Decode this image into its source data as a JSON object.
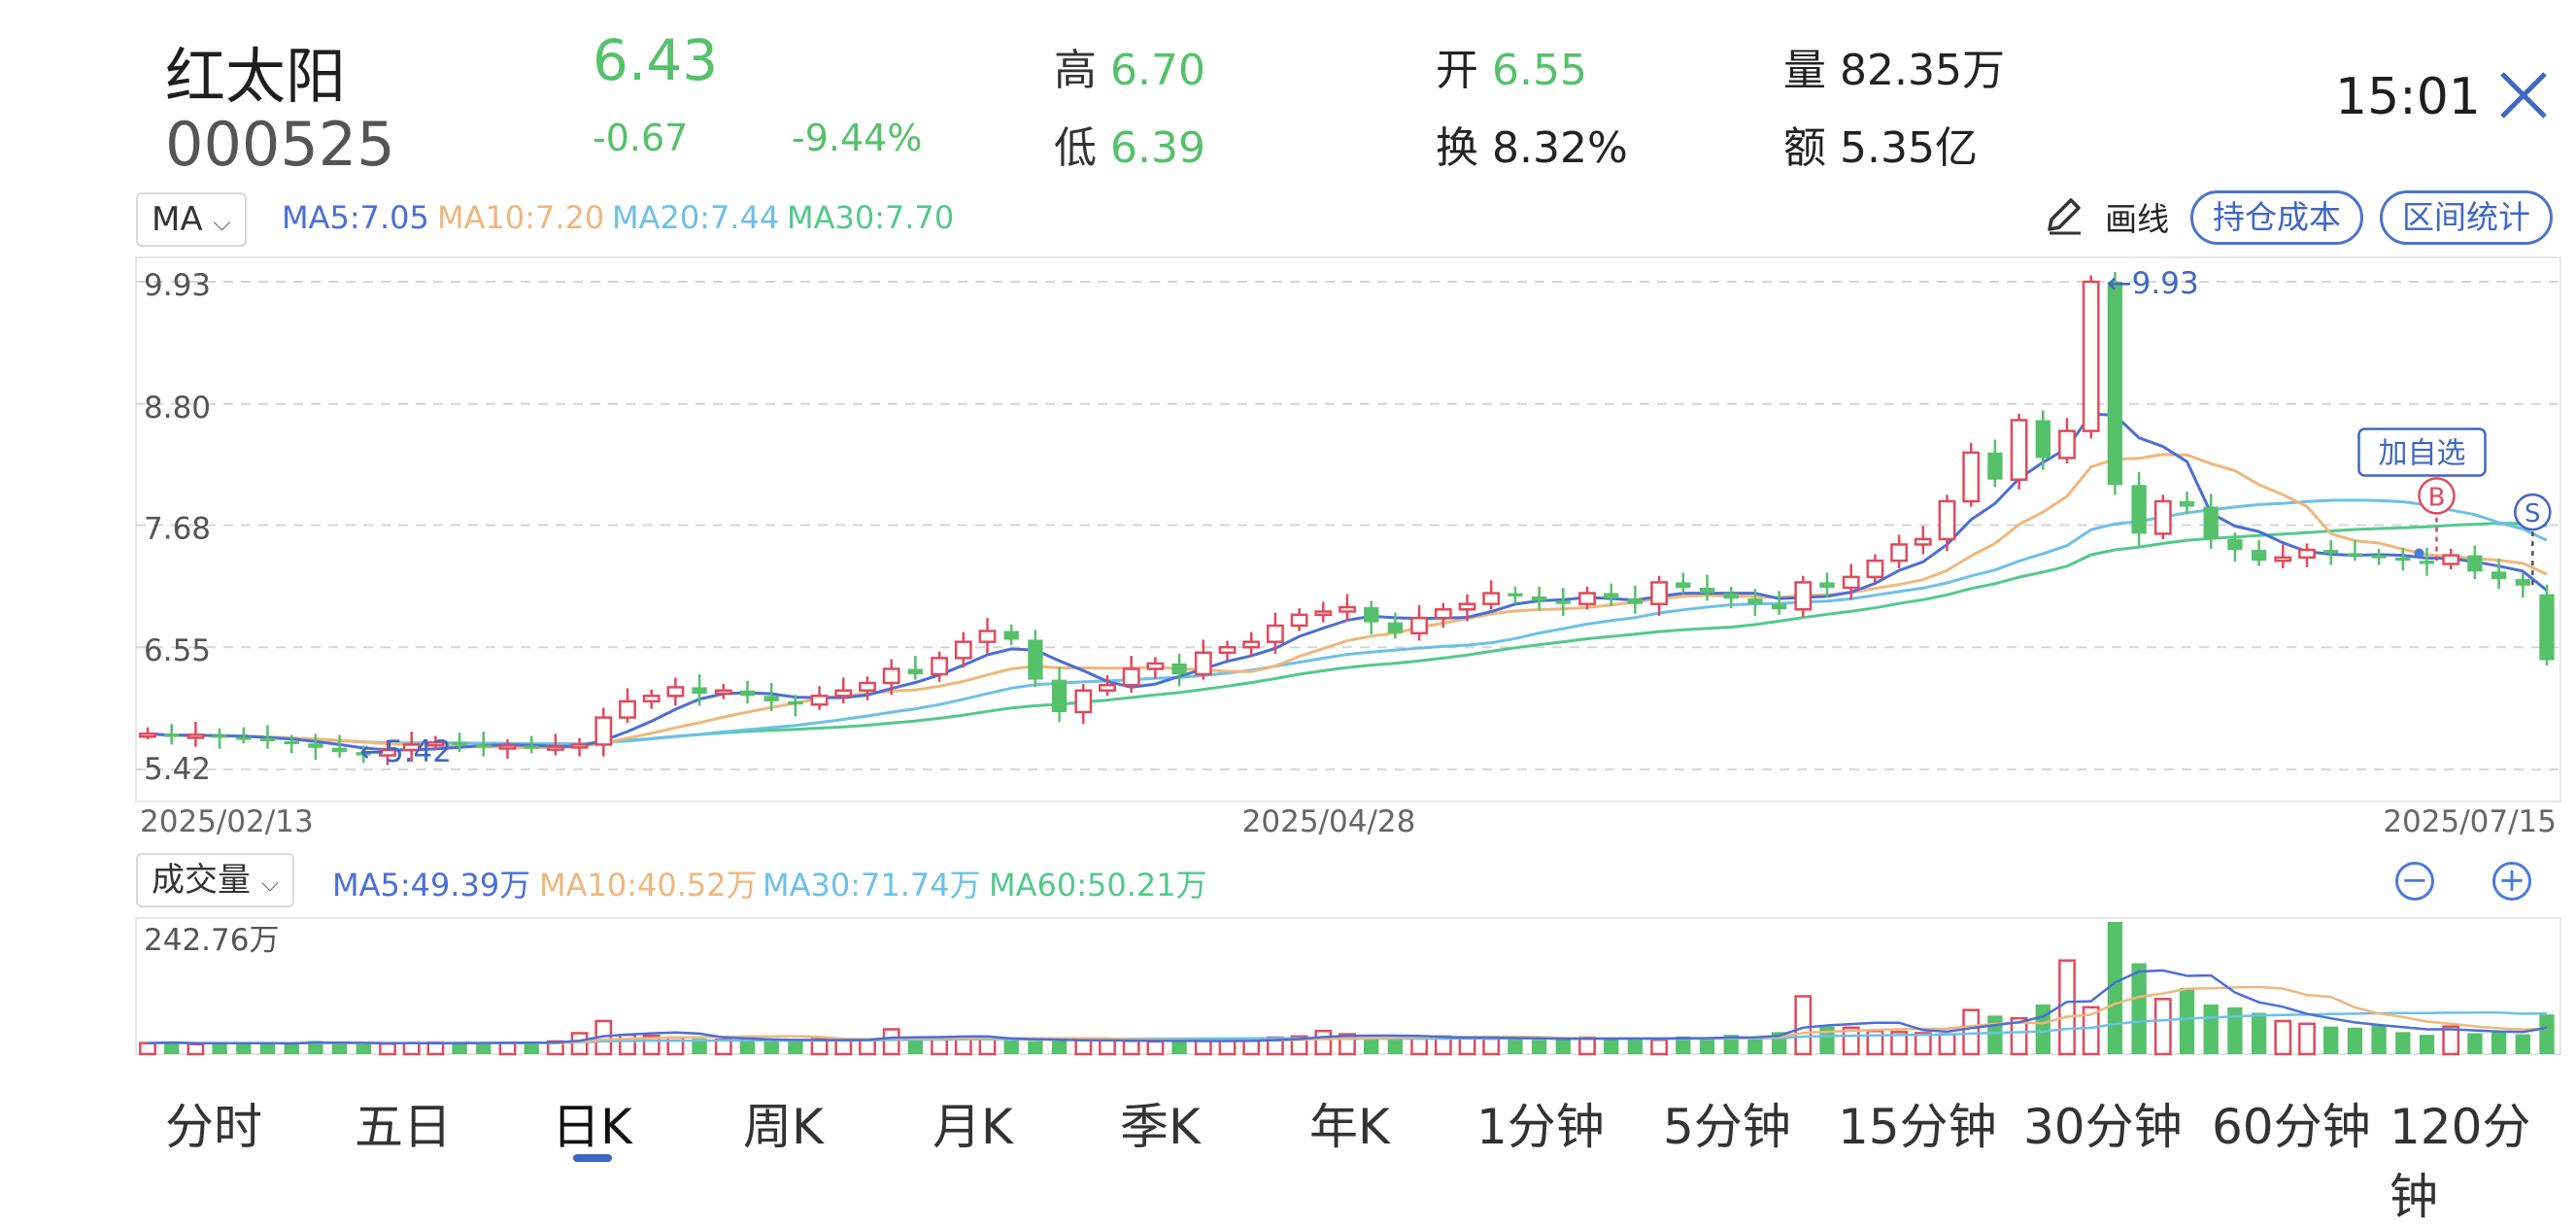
{
  "header": {
    "stock_name": "红太阳",
    "stock_code": "000525",
    "price": "6.43",
    "change": "-0.67",
    "change_pct": "-9.44%",
    "high_label": "高",
    "high_value": "6.70",
    "low_label": "低",
    "low_value": "6.39",
    "open_label": "开",
    "open_value": "6.55",
    "turnover_label": "换",
    "turnover_value": "8.32%",
    "volume_label": "量",
    "volume_value": "82.35万",
    "amount_label": "额",
    "amount_value": "5.35亿",
    "time": "15:01"
  },
  "indicators": {
    "selector": "MA",
    "ma5": "MA5:7.05",
    "ma10": "MA10:7.20",
    "ma20": "MA20:7.44",
    "ma30": "MA30:7.70",
    "draw_line": "画线",
    "hold_cost": "持仓成本",
    "range_stats": "区间统计"
  },
  "volume_indicators": {
    "selector": "成交量",
    "ma5": "MA5:49.39万",
    "ma10": "MA10:40.52万",
    "ma30": "MA30:71.74万",
    "ma60": "MA60:50.21万",
    "max_label": "242.76万"
  },
  "annotations": {
    "add_watchlist": "加自选",
    "buy_marker": "B",
    "sell_marker": "S",
    "max_price_marker": "←9.93",
    "min_price_marker": "←5.42"
  },
  "tabs": [
    "分时",
    "五日",
    "日K",
    "周K",
    "月K",
    "季K",
    "年K",
    "1分钟",
    "5分钟",
    "15分钟",
    "30分钟",
    "60分钟",
    "120分钟"
  ],
  "active_tab": "日K",
  "colors": {
    "up": "#e04a5b",
    "down": "#55c16a",
    "ma5": "#4a6fd8",
    "ma10": "#efb77b",
    "ma20": "#6cc0e8",
    "ma30": "#52c98c",
    "accent": "#3f67c3"
  },
  "chart_data": [
    {
      "type": "candlestick",
      "y_ticks": [
        "9.93",
        "8.80",
        "7.68",
        "6.55",
        "5.42"
      ],
      "ylim": [
        5.42,
        9.93
      ],
      "x_ticks": [
        "2025/02/13",
        "2025/04/28",
        "2025/07/15"
      ],
      "closes": [
        5.75,
        5.72,
        5.74,
        5.72,
        5.71,
        5.68,
        5.66,
        5.62,
        5.58,
        5.55,
        5.6,
        5.65,
        5.67,
        5.65,
        5.63,
        5.64,
        5.62,
        5.63,
        5.65,
        5.9,
        6.05,
        6.1,
        6.18,
        6.12,
        6.15,
        6.1,
        6.05,
        6.02,
        6.1,
        6.15,
        6.22,
        6.35,
        6.3,
        6.45,
        6.6,
        6.7,
        6.62,
        6.25,
        5.95,
        6.15,
        6.2,
        6.35,
        6.4,
        6.3,
        6.5,
        6.55,
        6.6,
        6.75,
        6.85,
        6.88,
        6.92,
        6.78,
        6.68,
        6.82,
        6.9,
        6.95,
        7.05,
        7.02,
        6.98,
        6.95,
        7.05,
        7.0,
        6.95,
        7.15,
        7.1,
        7.05,
        7.0,
        6.95,
        6.9,
        7.15,
        7.1,
        7.2,
        7.35,
        7.5,
        7.55,
        7.9,
        8.35,
        8.1,
        8.65,
        8.3,
        8.55,
        9.93,
        8.05,
        7.6,
        7.9,
        7.85,
        7.55,
        7.45,
        7.35,
        7.38,
        7.45,
        7.42,
        7.4,
        7.38,
        7.35,
        7.32,
        7.4,
        7.25,
        7.18,
        7.12,
        6.43
      ],
      "ma5_label": "7.05",
      "ma10_label": "7.20",
      "ma20_label": "7.44",
      "ma30_label": "7.70"
    },
    {
      "type": "bar",
      "title": "成交量",
      "max_label": "242.76万",
      "values": [
        20,
        22,
        18,
        19,
        20,
        21,
        19,
        24,
        20,
        18,
        19,
        20,
        21,
        22,
        19,
        20,
        21,
        23,
        38,
        60,
        35,
        33,
        30,
        28,
        26,
        25,
        24,
        26,
        27,
        25,
        26,
        45,
        30,
        28,
        31,
        27,
        25,
        24,
        24,
        25,
        26,
        24,
        23,
        22,
        24,
        25,
        26,
        30,
        32,
        42,
        36,
        28,
        30,
        29,
        32,
        30,
        28,
        27,
        26,
        28,
        30,
        29,
        28,
        26,
        32,
        30,
        35,
        30,
        40,
        105,
        50,
        48,
        42,
        40,
        38,
        36,
        80,
        70,
        65,
        90,
        170,
        85,
        240,
        165,
        100,
        120,
        90,
        85,
        75,
        60,
        55,
        50,
        48,
        52,
        40,
        35,
        50,
        38,
        42,
        36,
        72
      ]
    }
  ]
}
